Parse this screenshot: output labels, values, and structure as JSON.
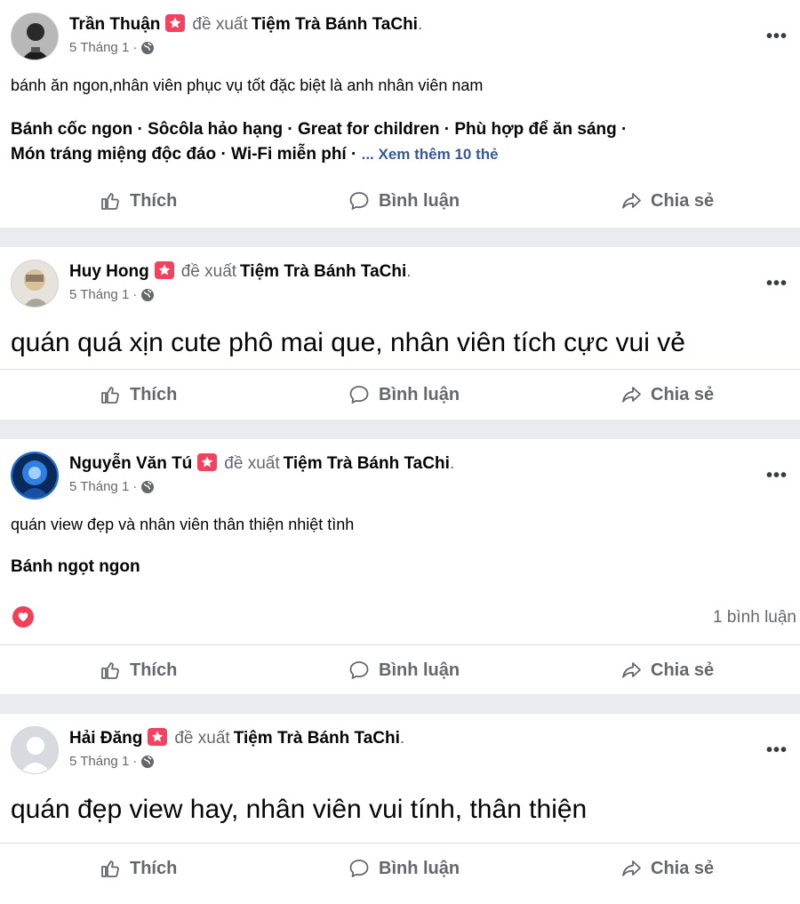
{
  "common": {
    "recommends": "đề xuất",
    "page_name": "Tiệm Trà Bánh TaChi",
    "date": "5 Tháng 1",
    "like": "Thích",
    "comment": "Bình luận",
    "share": "Chia sẻ",
    "more": "•••"
  },
  "posts": [
    {
      "author": "Trần Thuận",
      "text": "bánh ăn ngon,nhân viên phục vụ tốt đặc biệt là anh nhân viên nam",
      "tags_line1": "Bánh cốc ngon · Sôcôla hảo hạng · Great for children · Phù hợp để ăn sáng ·",
      "tags_line2": "Món tráng miệng độc đáo · Wi-Fi miễn phí · ",
      "see_more": "... Xem thêm 10 thẻ"
    },
    {
      "author": "Huy Hong",
      "text": "quán quá xịn cute phô mai que, nhân viên tích cực vui vẻ"
    },
    {
      "author": "Nguyễn Văn Tú",
      "text": "quán view đẹp và nhân viên thân thiện nhiệt tình",
      "tags_line1": "Bánh ngọt ngon",
      "comment_count": "1 bình luận"
    },
    {
      "author": "Hải Đăng",
      "text": "quán đẹp view hay, nhân viên vui tính, thân thiện"
    }
  ],
  "colors": {
    "badge": "#f3425f",
    "link": "#385898",
    "muted": "#65676b",
    "divider_bg": "#e9ebee"
  }
}
